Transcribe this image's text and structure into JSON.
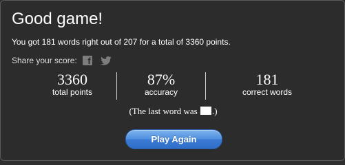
{
  "dialog": {
    "title": "Good game!",
    "summary": "You got 181 words right out of 207 for a total of 3360 points.",
    "share_label": "Share your score:"
  },
  "share": {
    "facebook_icon": "facebook-icon",
    "twitter_icon": "twitter-icon",
    "facebook_glyph": "f"
  },
  "stats": [
    {
      "value": "3360",
      "label": "total points"
    },
    {
      "value": "87%",
      "label": "accuracy"
    },
    {
      "value": "181",
      "label": "correct words"
    }
  ],
  "last_word": {
    "prefix": "(The last word was",
    "suffix": ".)"
  },
  "play_button": {
    "label": "Play Again"
  },
  "colors": {
    "background": "#2c2c2c",
    "text": "#ffffff",
    "button": "#4e8ee0"
  }
}
